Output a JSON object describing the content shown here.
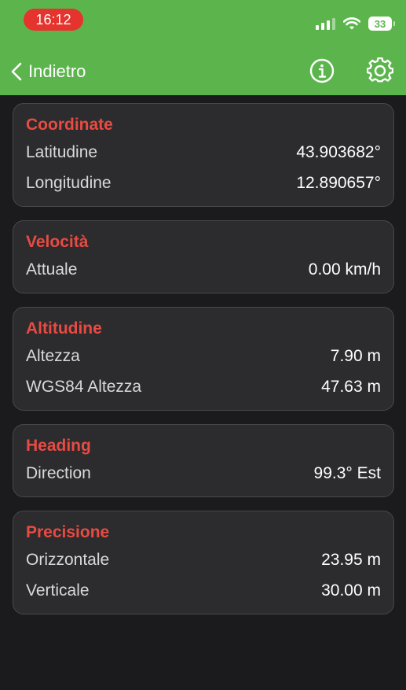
{
  "status_bar": {
    "time": "16:12",
    "battery": "33"
  },
  "nav": {
    "back_label": "Indietro"
  },
  "sections": [
    {
      "title": "Coordinate",
      "rows": [
        {
          "label": "Latitudine",
          "value": "43.903682°"
        },
        {
          "label": "Longitudine",
          "value": "12.890657°"
        }
      ]
    },
    {
      "title": "Velocità",
      "rows": [
        {
          "label": "Attuale",
          "value": "0.00 km/h"
        }
      ]
    },
    {
      "title": "Altitudine",
      "rows": [
        {
          "label": "Altezza",
          "value": "7.90 m"
        },
        {
          "label": "WGS84 Altezza",
          "value": "47.63 m"
        }
      ]
    },
    {
      "title": "Heading",
      "rows": [
        {
          "label": "Direction",
          "value": "99.3° Est"
        }
      ]
    },
    {
      "title": "Precisione",
      "rows": [
        {
          "label": "Orizzontale",
          "value": "23.95 m"
        },
        {
          "label": "Verticale",
          "value": "30.00 m"
        }
      ]
    }
  ],
  "colors": {
    "header": "#5cb54c",
    "section_title": "#e84b42",
    "time_pill": "#e5332e",
    "background": "#1b1b1d",
    "card": "#2c2b2e"
  },
  "icons": [
    "chevron-left-icon",
    "info-icon",
    "gear-icon",
    "signal-icon",
    "wifi-icon",
    "battery-icon"
  ]
}
